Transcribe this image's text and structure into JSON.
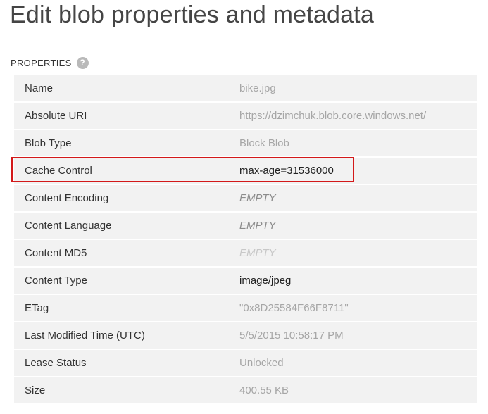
{
  "page": {
    "title": "Edit blob properties and metadata"
  },
  "properties": {
    "section_label": "PROPERTIES",
    "help_icon": "question-mark-icon",
    "rows": [
      {
        "label": "Name",
        "value": "bike.jpg",
        "state": "readonly"
      },
      {
        "label": "Absolute URI",
        "value": "https://dzimchuk.blob.core.windows.net/",
        "state": "readonly"
      },
      {
        "label": "Blob Type",
        "value": "Block Blob",
        "state": "readonly"
      },
      {
        "label": "Cache Control",
        "value": "max-age=31536000",
        "state": "editable"
      },
      {
        "label": "Content Encoding",
        "value": "EMPTY",
        "state": "empty"
      },
      {
        "label": "Content Language",
        "value": "EMPTY",
        "state": "empty"
      },
      {
        "label": "Content MD5",
        "value": "EMPTY",
        "state": "empty-disabled"
      },
      {
        "label": "Content Type",
        "value": "image/jpeg",
        "state": "editable"
      },
      {
        "label": "ETag",
        "value": "\"0x8D25584F66F8711\"",
        "state": "readonly"
      },
      {
        "label": "Last Modified Time (UTC)",
        "value": "5/5/2015 10:58:17 PM",
        "state": "readonly"
      },
      {
        "label": "Lease Status",
        "value": "Unlocked",
        "state": "readonly"
      },
      {
        "label": "Size",
        "value": "400.55 KB",
        "state": "readonly"
      }
    ]
  },
  "colors": {
    "highlight_border": "#d3191a",
    "row_background": "#f2f2f2",
    "readonly_text": "#a6a6a6"
  }
}
